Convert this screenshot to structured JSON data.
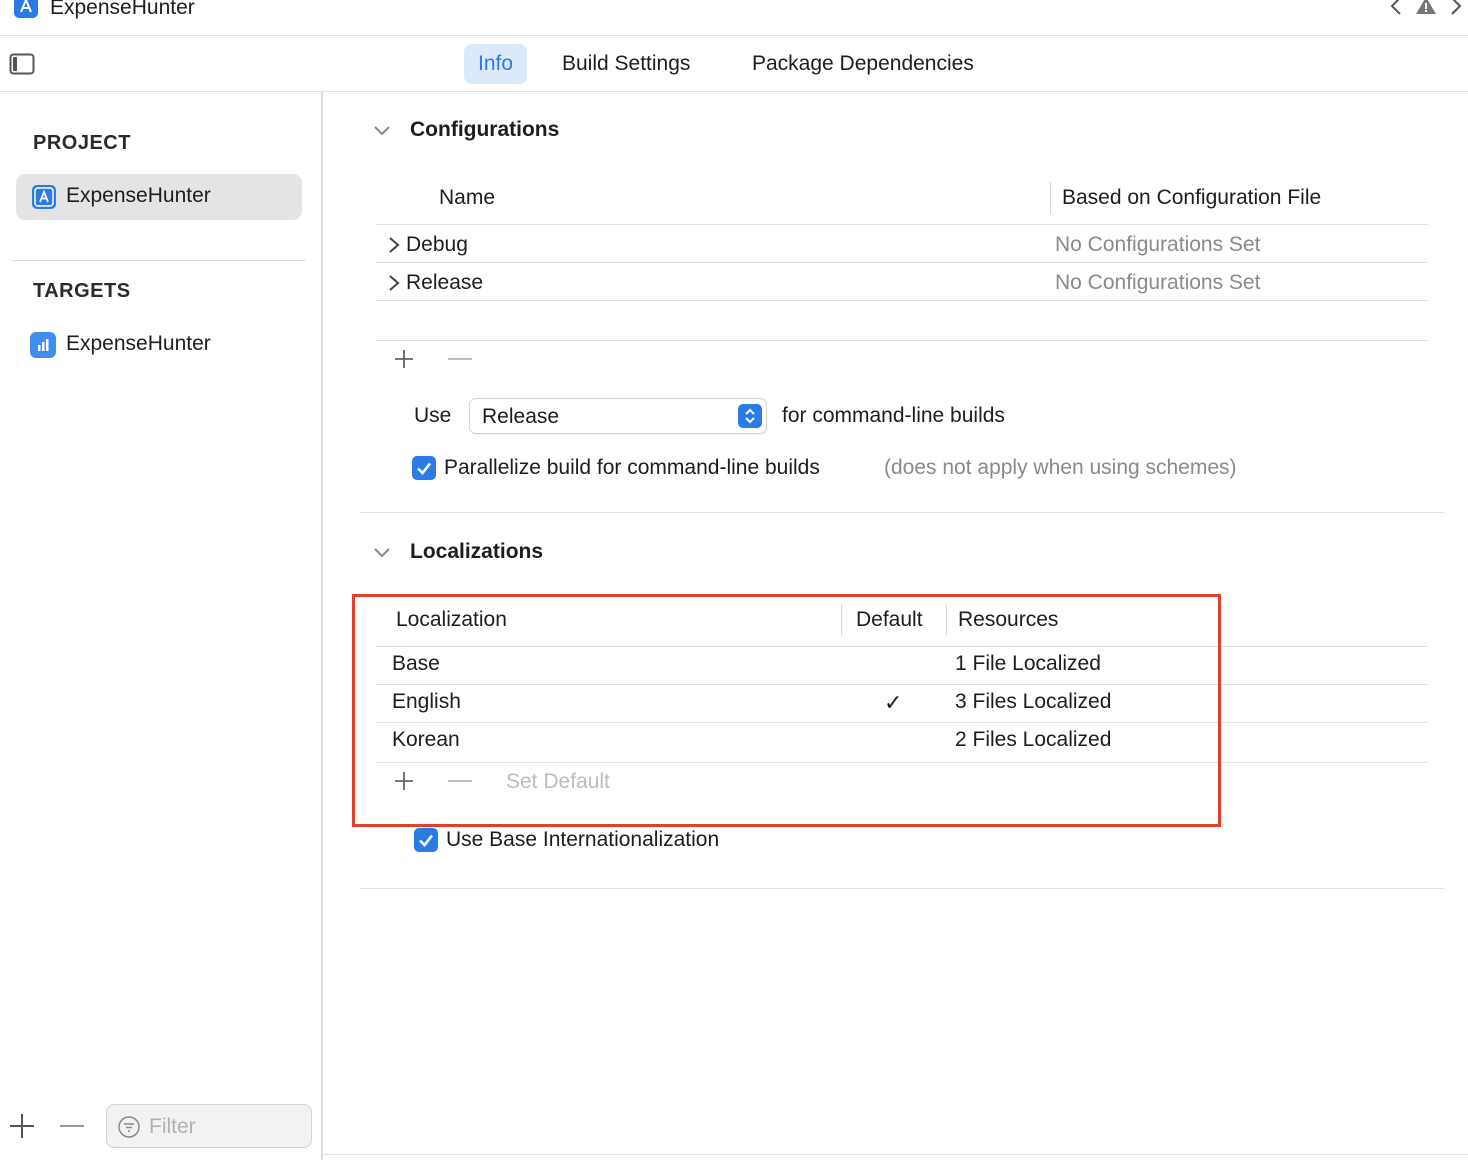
{
  "window": {
    "title": "ExpenseHunter"
  },
  "tabs": [
    {
      "label": "Info",
      "selected": true
    },
    {
      "label": "Build Settings",
      "selected": false
    },
    {
      "label": "Package Dependencies",
      "selected": false
    }
  ],
  "sidebar": {
    "project_heading": "PROJECT",
    "project_item": "ExpenseHunter",
    "targets_heading": "TARGETS",
    "target_item": "ExpenseHunter",
    "filter_placeholder": "Filter"
  },
  "configurations": {
    "title": "Configurations",
    "columns": {
      "name": "Name",
      "file": "Based on Configuration File"
    },
    "rows": [
      {
        "name": "Debug",
        "file": "No Configurations Set"
      },
      {
        "name": "Release",
        "file": "No Configurations Set"
      }
    ],
    "use_label": "Use",
    "use_value": "Release",
    "use_suffix": "for command-line builds",
    "parallelize_label": "Parallelize build for command-line builds",
    "parallelize_note": "(does not apply when using schemes)",
    "parallelize_checked": true
  },
  "localizations": {
    "title": "Localizations",
    "columns": {
      "localization": "Localization",
      "default": "Default",
      "resources": "Resources"
    },
    "rows": [
      {
        "name": "Base",
        "default": "",
        "resources": "1 File Localized"
      },
      {
        "name": "English",
        "default": "✓",
        "resources": "3 Files Localized"
      },
      {
        "name": "Korean",
        "default": "",
        "resources": "2 Files Localized"
      }
    ],
    "set_default_label": "Set Default",
    "use_base_label": "Use Base Internationalization",
    "use_base_checked": true
  },
  "colors": {
    "accent": "#2a7be4",
    "highlight": "#e0402c",
    "selected_tab_bg": "#dce9fa"
  },
  "icons": {
    "app": "xcode-project-icon",
    "target": "app-target-icon",
    "nav_back": "chevron-left-icon",
    "nav_forward": "chevron-right-icon",
    "warning": "warning-icon",
    "sidebar_toggle": "sidebar-toggle-icon",
    "filter": "filter-icon"
  }
}
